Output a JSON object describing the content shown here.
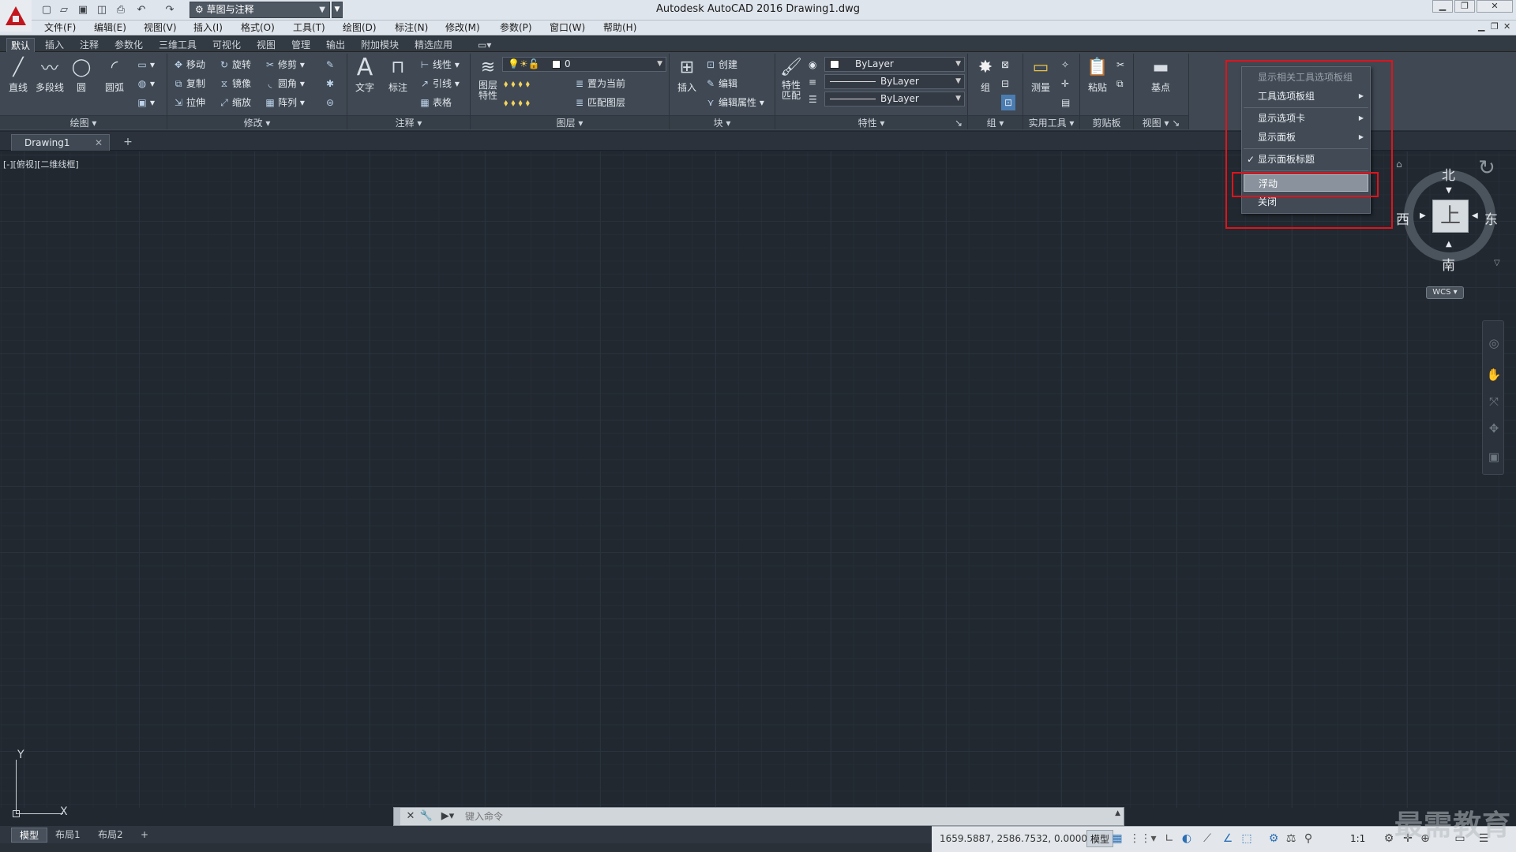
{
  "app": {
    "title": "Autodesk AutoCAD 2016    Drawing1.dwg",
    "workspace": "草图与注释"
  },
  "menu": [
    "文件(F)",
    "编辑(E)",
    "视图(V)",
    "插入(I)",
    "格式(O)",
    "工具(T)",
    "绘图(D)",
    "标注(N)",
    "修改(M)",
    "参数(P)",
    "窗口(W)",
    "帮助(H)"
  ],
  "ribbon_tabs": [
    "默认",
    "插入",
    "注释",
    "参数化",
    "三维工具",
    "可视化",
    "视图",
    "管理",
    "输出",
    "附加模块",
    "精选应用"
  ],
  "panels": {
    "draw": {
      "title": "绘图",
      "line": "直线",
      "polyline": "多段线",
      "circle": "圆",
      "arc": "圆弧"
    },
    "modify": {
      "title": "修改",
      "move": "移动",
      "rotate": "旋转",
      "trim": "修剪",
      "copy": "复制",
      "mirror": "镜像",
      "fillet": "圆角",
      "stretch": "拉伸",
      "scale": "缩放",
      "array": "阵列"
    },
    "annotation": {
      "title": "注释",
      "text": "文字",
      "dimension": "标注",
      "linear": "线性",
      "leader": "引线",
      "table": "表格"
    },
    "layers": {
      "title": "图层",
      "props": "图层\n特性",
      "layer_value": "0",
      "set_current": "置为当前",
      "match_layer": "匹配图层"
    },
    "block": {
      "title": "块",
      "insert": "插入",
      "create": "创建",
      "edit": "编辑",
      "edit_attr": "编辑属性"
    },
    "properties": {
      "title": "特性",
      "match": "特性\n匹配",
      "color": "ByLayer",
      "linetype": "ByLayer",
      "lineweight": "ByLayer"
    },
    "groups": {
      "title": "组",
      "group": "组"
    },
    "utilities": {
      "title": "实用工具",
      "measure": "测量"
    },
    "clipboard": {
      "title": "剪贴板",
      "paste": "粘贴"
    },
    "view": {
      "title": "视图",
      "base": "基点"
    }
  },
  "file_tab": "Drawing1",
  "viewport_label": "[-][俯视][二维线框]",
  "ucs": {
    "x": "X",
    "y": "Y"
  },
  "viewcube": {
    "north": "北",
    "south": "南",
    "east": "东",
    "west": "西",
    "face": "上",
    "wcs": "WCS"
  },
  "context_menu": {
    "items": [
      {
        "label": "显示相关工具选项板组",
        "disabled": true
      },
      {
        "label": "工具选项板组",
        "submenu": true
      },
      {
        "label": "显示选项卡",
        "submenu": true
      },
      {
        "label": "显示面板",
        "submenu": true
      },
      {
        "label": "显示面板标题",
        "checked": true
      },
      {
        "label": "浮动",
        "highlighted": true
      },
      {
        "label": "关闭"
      }
    ]
  },
  "command_line": {
    "placeholder": "键入命令"
  },
  "layout_tabs": [
    "模型",
    "布局1",
    "布局2"
  ],
  "status": {
    "coords": "1659.5887, 2586.7532, 0.0000",
    "model": "模型",
    "scale": "1:1"
  },
  "watermark": "最需教育",
  "colors": {
    "highlight_box": "#e1131b",
    "canvas": "#212830",
    "ribbon": "#3f4853"
  }
}
